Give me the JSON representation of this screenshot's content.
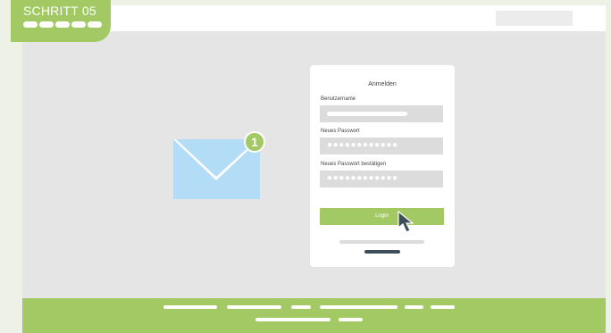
{
  "step_badge": {
    "label": "SCHRITT 05",
    "progress_dots": 5
  },
  "notification": {
    "count": "1"
  },
  "login_form": {
    "title": "Anmelden",
    "username_label": "Benutzername",
    "new_password_label": "Neues Passwort",
    "new_password_value": "●●●●●●●●●●●●",
    "confirm_password_label": "Neues Passwort bestätigen",
    "confirm_password_value": "●●●●●●●●●●●●",
    "login_button": "Login"
  },
  "colors": {
    "accent_green": "#a2c963",
    "envelope_blue": "#b3dcf6",
    "page_grey": "#e5e5e5",
    "dark_link": "#3e4e58"
  },
  "icons": [
    "envelope-icon",
    "mouse-cursor-icon"
  ]
}
